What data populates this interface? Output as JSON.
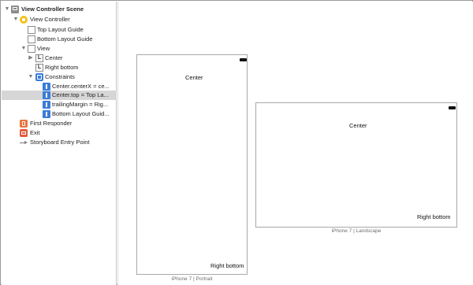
{
  "outline": {
    "items": [
      {
        "label": "View Controller Scene",
        "icon": "scene-icon"
      },
      {
        "label": "View Controller",
        "icon": "view-controller-icon"
      },
      {
        "label": "Top Layout Guide",
        "icon": "layout-guide-icon"
      },
      {
        "label": "Bottom Layout Guide",
        "icon": "layout-guide-icon"
      },
      {
        "label": "View",
        "icon": "view-icon"
      },
      {
        "label": "Center",
        "icon": "label-icon",
        "glyph": "L"
      },
      {
        "label": "Right bottom",
        "icon": "label-icon",
        "glyph": "L"
      },
      {
        "label": "Constraints",
        "icon": "constraints-icon"
      },
      {
        "label": "Center.centerX = ce...",
        "icon": "constraint-icon"
      },
      {
        "label": "Center.top = Top La...",
        "icon": "constraint-icon"
      },
      {
        "label": "trailingMargin = Rig...",
        "icon": "constraint-icon"
      },
      {
        "label": "Bottom Layout Guid...",
        "icon": "constraint-icon"
      },
      {
        "label": "First Responder",
        "icon": "first-responder-icon"
      },
      {
        "label": "Exit",
        "icon": "exit-icon"
      },
      {
        "label": "Storyboard Entry Point",
        "icon": "entry-point-arrow-icon"
      }
    ]
  },
  "canvas": {
    "portrait": {
      "center_label": "Center",
      "right_bottom_label": "Right bottom",
      "caption": "iPhone 7 | Portrait"
    },
    "landscape": {
      "center_label": "Center",
      "right_bottom_label": "Right bottom",
      "caption": "iPhone 7 | Landscape"
    }
  },
  "colors": {
    "selection": "#d6d6d6",
    "constraint_blue": "#3b7dd8",
    "view_controller_yellow": "#f3c017",
    "first_responder_orange": "#e8743b",
    "exit_red": "#e25b3b"
  }
}
